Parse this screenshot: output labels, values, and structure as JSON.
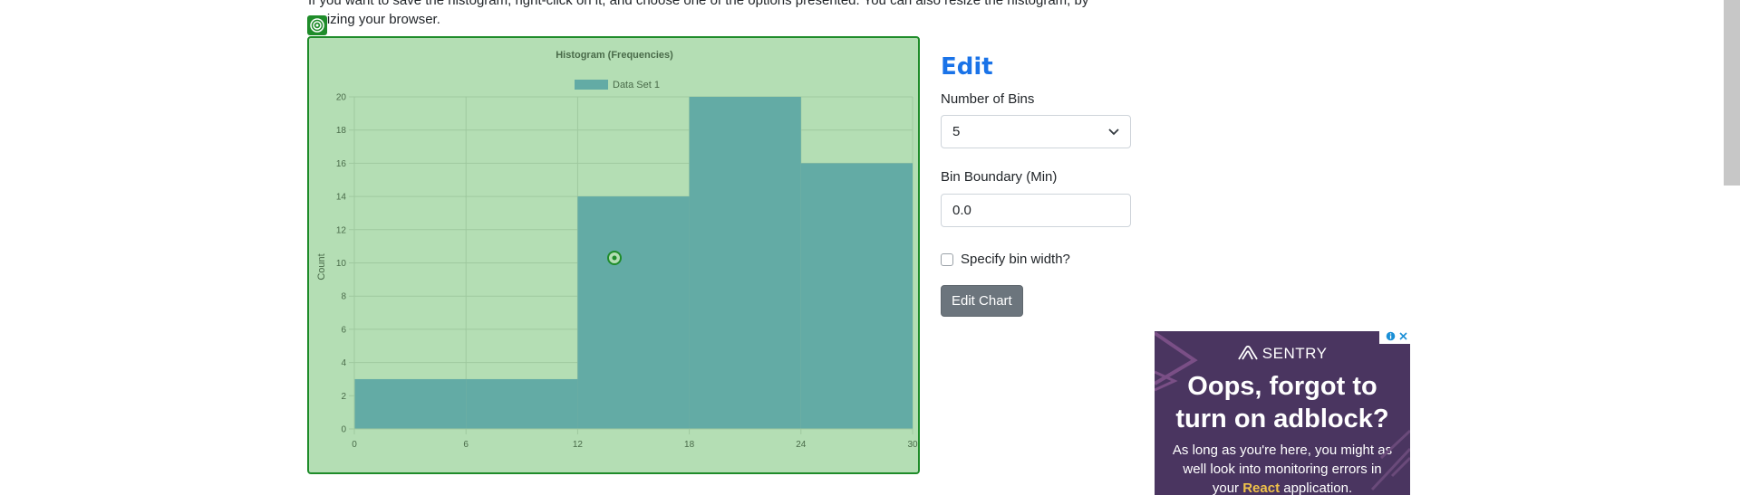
{
  "intro_text": {
    "line1": "If you want to save the histogram, right-click on it, and choose one of the options presented. You can also resize the histogram, by",
    "line2": "resizing your browser."
  },
  "chart_data": {
    "type": "bar",
    "title": "Histogram (Frequencies)",
    "legend": [
      "Data Set 1"
    ],
    "legend_position": "top",
    "xlabel": "",
    "ylabel": "Count",
    "x_ticks": [
      0,
      6,
      12,
      18,
      24,
      30
    ],
    "y_ticks": [
      0,
      2,
      4,
      6,
      8,
      10,
      12,
      14,
      16,
      18,
      20
    ],
    "xlim": [
      0,
      30
    ],
    "ylim": [
      0,
      20
    ],
    "grid": true,
    "series": [
      {
        "name": "Data Set 1",
        "bins": [
          [
            0,
            6
          ],
          [
            6,
            12
          ],
          [
            12,
            18
          ],
          [
            18,
            24
          ],
          [
            24,
            30
          ]
        ],
        "values": [
          3,
          3,
          14,
          20,
          16
        ]
      }
    ],
    "colors": {
      "background": "#b4deb4",
      "bar": "#63aba5",
      "grid": "#9fc99f",
      "text": "#4a6b4a",
      "border": "#1f8c2a"
    }
  },
  "edit": {
    "title": "Edit",
    "bins_label": "Number of Bins",
    "bins_value": "5",
    "boundary_label": "Bin Boundary (Min)",
    "boundary_value": "0.0",
    "width_checkbox_label": "Specify bin width?",
    "width_checked": false,
    "button_label": "Edit Chart"
  },
  "ad": {
    "brand": "SENTRY",
    "headline_line1": "Oops, forgot to",
    "headline_line2": "turn on adblock?",
    "body_line1": "As long as you're here, you might as",
    "body_line2": "well look into monitoring errors in",
    "body_prefix": "your",
    "body_highlight": "React",
    "body_suffix": "application.",
    "info_icon": "info-icon",
    "close_icon": "close-icon"
  }
}
